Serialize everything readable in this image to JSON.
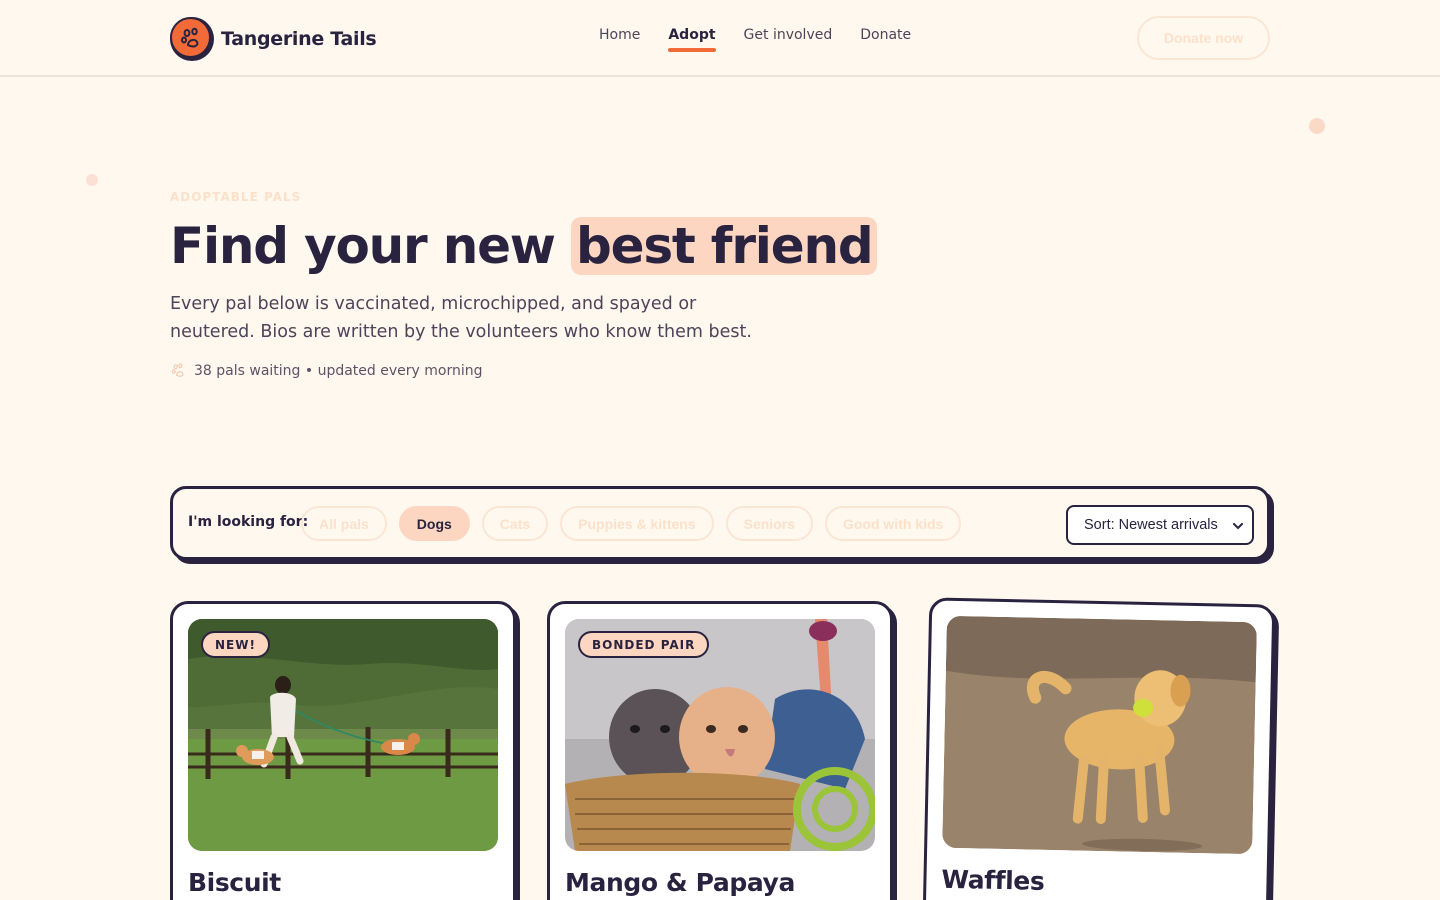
{
  "header": {
    "brand_name": "Tangerine Tails",
    "nav": [
      {
        "label": "Home",
        "active": false
      },
      {
        "label": "Adopt",
        "active": true
      },
      {
        "label": "Get involved",
        "active": false
      },
      {
        "label": "Donate",
        "active": false
      }
    ],
    "cta_label": "Donate now"
  },
  "hero": {
    "eyebrow": "ADOPTABLE PALS",
    "title_prefix": "Find your new",
    "title_highlight": "best friend",
    "subtitle": "Every pal below is vaccinated, microchipped, and spayed or neutered. Bios are written by the volunteers who know them best.",
    "meta": "38 pals waiting • updated every morning",
    "meta_icon": "paw-icon"
  },
  "filters": {
    "label": "I'm looking for:",
    "chips": [
      {
        "label": "All pals",
        "active": false
      },
      {
        "label": "Dogs",
        "active": true
      },
      {
        "label": "Cats",
        "active": false
      },
      {
        "label": "Puppies & kittens",
        "active": false
      },
      {
        "label": "Seniors",
        "active": false
      },
      {
        "label": "Good with kids",
        "active": false
      }
    ],
    "sort_value": "Sort: Newest arrivals"
  },
  "cards": [
    {
      "name": "Biscuit",
      "badge": "NEW!",
      "photo": "person walking two corgis on a grassy hill"
    },
    {
      "name": "Mango & Papaya",
      "badge": "BONDED PAIR",
      "photo": "two kittens in a wicker basket"
    },
    {
      "name": "Waffles",
      "badge": "",
      "photo": "golden retriever holding a tennis ball"
    }
  ],
  "colors": {
    "accent": "#f26a38",
    "ink": "#2a2340",
    "background": "#fff8ef",
    "highlight": "#fdd6c2"
  }
}
